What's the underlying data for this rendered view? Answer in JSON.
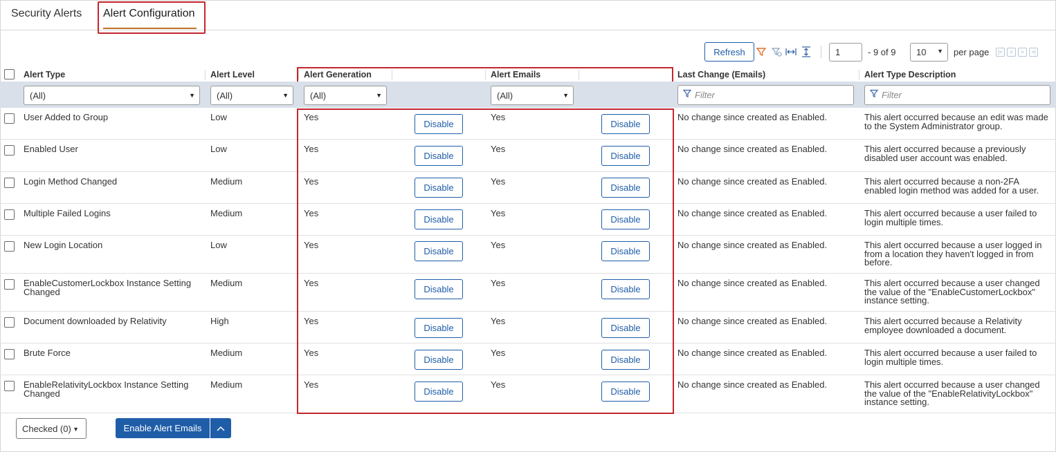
{
  "tabs": [
    {
      "label": "Security Alerts"
    },
    {
      "label": "Alert Configuration"
    }
  ],
  "toolbar": {
    "refresh_label": "Refresh",
    "icons": [
      "filter-icon",
      "clear-filter-icon",
      "fit-columns-icon",
      "expand-rows-icon"
    ],
    "page_value": "1",
    "page_of": "- 9 of 9",
    "per_page_value": "10",
    "per_page_label": "per page"
  },
  "columns": {
    "alert_type": "Alert Type",
    "alert_level": "Alert Level",
    "alert_generation": "Alert Generation",
    "alert_emails": "Alert Emails",
    "last_change": "Last Change (Emails)",
    "description": "Alert Type Description"
  },
  "filters": {
    "alert_type": "(All)",
    "alert_level": "(All)",
    "alert_generation": "(All)",
    "alert_emails": "(All)",
    "last_change_placeholder": "Filter",
    "description_placeholder": "Filter"
  },
  "rows": [
    {
      "type": "User Added to Group",
      "level": "Low",
      "generation": "Yes",
      "gen_btn": "Disable",
      "emails": "Yes",
      "email_btn": "Disable",
      "last_change": "No change since created as Enabled.",
      "description": "This alert occurred because an edit was made to the System Administrator group."
    },
    {
      "type": "Enabled User",
      "level": "Low",
      "generation": "Yes",
      "gen_btn": "Disable",
      "emails": "Yes",
      "email_btn": "Disable",
      "last_change": "No change since created as Enabled.",
      "description": "This alert occurred because a previously disabled user account was enabled."
    },
    {
      "type": "Login Method Changed",
      "level": "Medium",
      "generation": "Yes",
      "gen_btn": "Disable",
      "emails": "Yes",
      "email_btn": "Disable",
      "last_change": "No change since created as Enabled.",
      "description": "This alert occurred because a non-2FA enabled login method was added for a user."
    },
    {
      "type": "Multiple Failed Logins",
      "level": "Medium",
      "generation": "Yes",
      "gen_btn": "Disable",
      "emails": "Yes",
      "email_btn": "Disable",
      "last_change": "No change since created as Enabled.",
      "description": "This alert occurred because a user failed to login multiple times."
    },
    {
      "type": "New Login Location",
      "level": "Low",
      "generation": "Yes",
      "gen_btn": "Disable",
      "emails": "Yes",
      "email_btn": "Disable",
      "last_change": "No change since created as Enabled.",
      "description": "This alert occurred because a user logged in from a location they haven't logged in from before."
    },
    {
      "type": "EnableCustomerLockbox Instance Setting Changed",
      "level": "Medium",
      "generation": "Yes",
      "gen_btn": "Disable",
      "emails": "Yes",
      "email_btn": "Disable",
      "last_change": "No change since created as Enabled.",
      "description": "This alert occurred because a user changed the value of the \"EnableCustomerLockbox\" instance setting."
    },
    {
      "type": "Document downloaded by Relativity",
      "level": "High",
      "generation": "Yes",
      "gen_btn": "Disable",
      "emails": "Yes",
      "email_btn": "Disable",
      "last_change": "No change since created as Enabled.",
      "description": "This alert occurred because a Relativity employee downloaded a document."
    },
    {
      "type": "Brute Force",
      "level": "Medium",
      "generation": "Yes",
      "gen_btn": "Disable",
      "emails": "Yes",
      "email_btn": "Disable",
      "last_change": "No change since created as Enabled.",
      "description": "This alert occurred because a user failed to login multiple times."
    },
    {
      "type": "EnableRelativityLockbox Instance Setting Changed",
      "level": "Medium",
      "generation": "Yes",
      "gen_btn": "Disable",
      "emails": "Yes",
      "email_btn": "Disable",
      "last_change": "No change since created as Enabled.",
      "description": "This alert occurred because a user changed the value of the \"EnableRelativityLockbox\" instance setting."
    }
  ],
  "footer": {
    "checked_label": "Checked (0)",
    "enable_label": "Enable Alert Emails"
  },
  "colors": {
    "accent": "#1f5da8",
    "highlight_border": "#c4262e",
    "tab_underline": "#c27328",
    "filter_bar": "#d9e0ea"
  }
}
